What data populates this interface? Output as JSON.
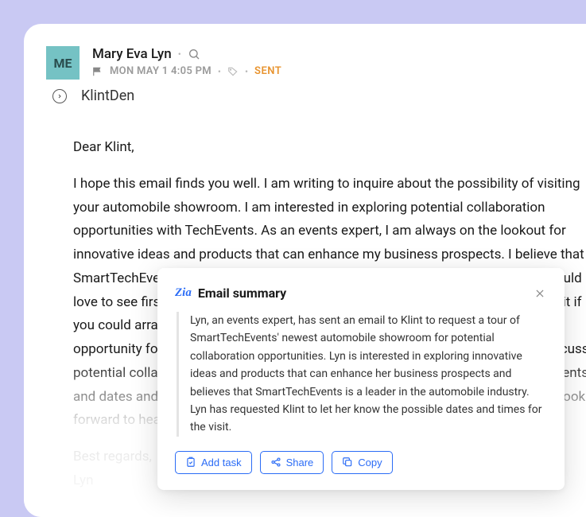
{
  "avatar_initials": "ME",
  "sender": {
    "name": "Mary Eva Lyn",
    "date": "MON MAY 1 4:05 PM",
    "status": "SENT"
  },
  "subject": "KlintDen",
  "body": {
    "greeting": "Dear Klint,",
    "para1": "I hope this email finds you well. I am writing to inquire about the possibility of visiting your automobile showroom. I am interested in exploring potential collaboration opportunities with TechEvents. As an events expert, I am always on the lookout for innovative ideas and products that can enhance my business prospects. I believe that SmartTechEvents has a reputation as a leader in the automobile industry, and I would love to see firsthand what your newest showroom has to offer. I would appreciate it if you could arrange a visit at your earliest convenience. It would be an excellent opportunity for me to learn more about SmartTechEvents' products, as well as discuss potential collaboration opportunities. Please let me know what possible arrangements and dates and times would work best for you. Thank you for your consideration. I look forward to hearing from you.",
    "signoff1": "Best regards,",
    "signoff2": "Lyn"
  },
  "summary_popup": {
    "title": "Email summary",
    "zia_label": "Zia",
    "text": "Lyn, an events expert, has sent an email to Klint to request a tour of SmartTechEvents' newest automobile showroom for potential collaboration opportunities. Lyn is interested in exploring innovative ideas and products that can enhance her business prospects and believes that SmartTechEvents is a leader in the automobile industry. Lyn has requested Klint to let her know the possible dates and times for the visit.",
    "actions": {
      "add_task": "Add task",
      "share": "Share",
      "copy": "Copy"
    }
  }
}
